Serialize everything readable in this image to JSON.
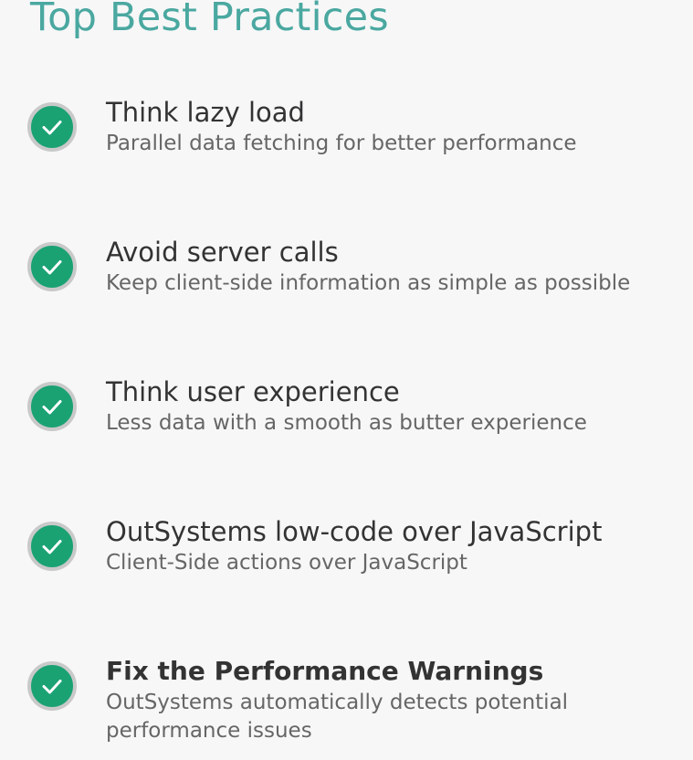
{
  "title": "Top Best Practices",
  "items": [
    {
      "title": "Think lazy load",
      "description": "Parallel data fetching for better performance",
      "icon": "check-circle-icon"
    },
    {
      "title": "Avoid server calls",
      "description": "Keep client-side information as simple as possible",
      "icon": "check-circle-icon"
    },
    {
      "title": "Think user experience",
      "description": "Less data with a smooth as butter experience",
      "icon": "check-circle-icon"
    },
    {
      "title": "OutSystems low-code over JavaScript",
      "description": "Client-Side actions over JavaScript",
      "icon": "check-circle-icon"
    },
    {
      "title": "Fix the Performance Warnings",
      "description": "OutSystems automatically detects potential performance issues",
      "icon": "check-circle-icon"
    }
  ],
  "colors": {
    "title": "#4aa8a0",
    "check_fill": "#1aa273",
    "check_ring": "#c9c9c9",
    "background": "#f7f7f8"
  }
}
